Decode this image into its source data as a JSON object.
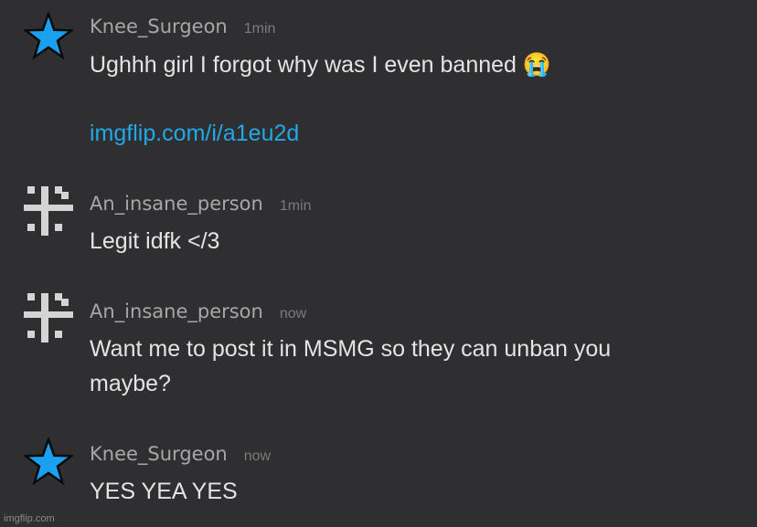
{
  "messages": [
    {
      "username": "Knee_Surgeon",
      "time": "1min",
      "avatar": "blue-star-icon",
      "text": "Ughhh girl I forgot why was I even banned",
      "emoji": "😭",
      "link": "imgflip.com/i/a1eu2d"
    },
    {
      "username": "An_insane_person",
      "time": "1min",
      "avatar": "gray-grid-icon",
      "text": "Legit idfk </3"
    },
    {
      "username": "An_insane_person",
      "time": "now",
      "avatar": "gray-grid-icon",
      "text_line1": "Want me to post it in MSMG so they can unban you",
      "text_line2": "maybe?"
    },
    {
      "username": "Knee_Surgeon",
      "time": "now",
      "avatar": "blue-star-icon",
      "text": "YES YEA YES"
    }
  ],
  "watermark": "imgflip.com",
  "colors": {
    "background": "#2f2f31",
    "star": "#1aa0f0",
    "link": "#21a8e8",
    "username": "#a7a7a7",
    "timestamp": "#7b7b7b"
  }
}
